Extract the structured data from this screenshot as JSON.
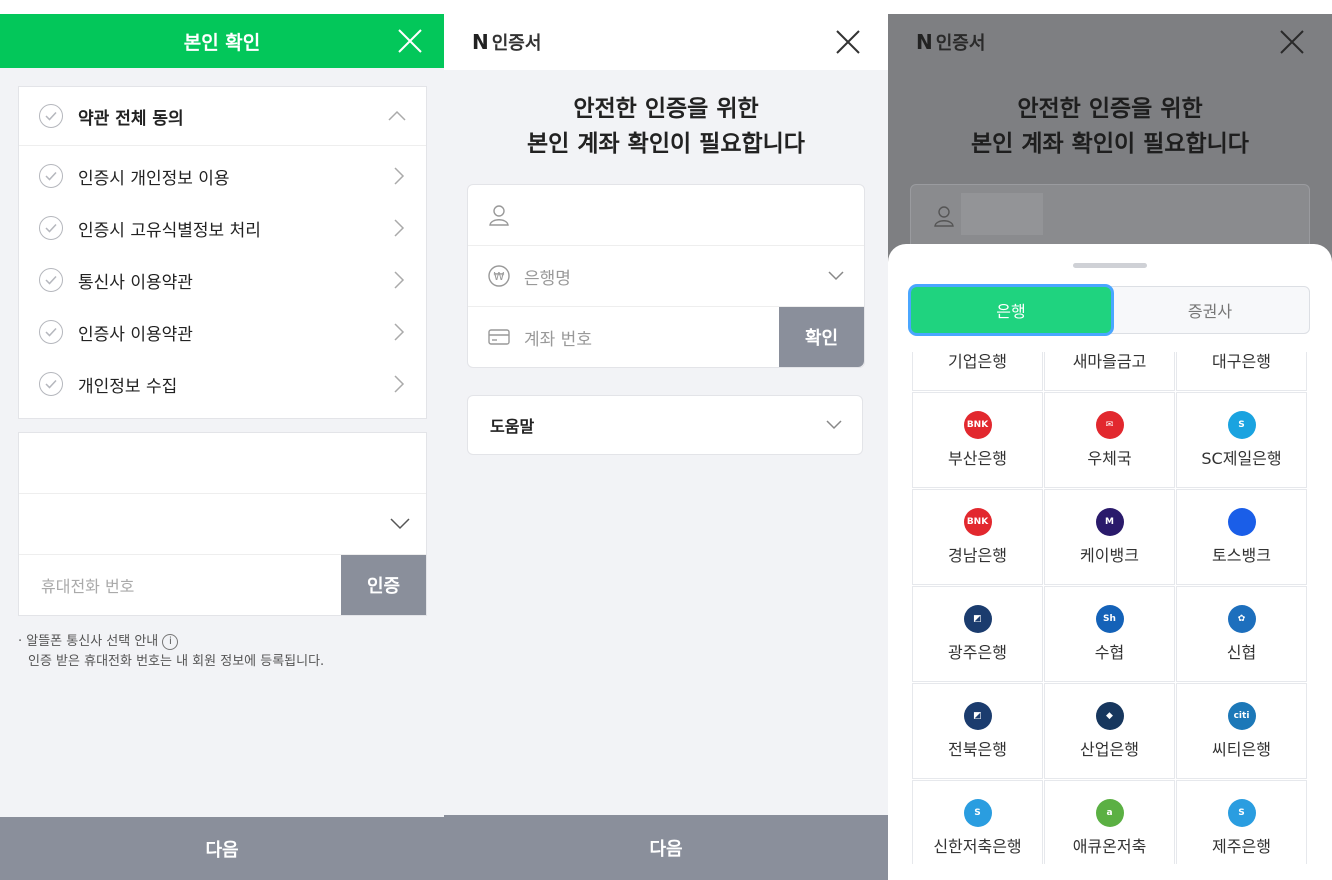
{
  "panel1": {
    "title": "본인 확인",
    "terms": [
      {
        "label": "약관 전체 동의"
      },
      {
        "label": "인증시 개인정보 이용"
      },
      {
        "label": "인증시 고유식별정보 처리"
      },
      {
        "label": "통신사 이용약관"
      },
      {
        "label": "인증사 이용약관"
      },
      {
        "label": "개인정보 수집"
      }
    ],
    "phone_placeholder": "휴대전화 번호",
    "verify_button": "인증",
    "note_line1": "알뜰폰 통신사 선택 안내",
    "note_line2": "인증 받은 휴대전화 번호는 내 회원 정보에 등록됩니다.",
    "next_button": "다음"
  },
  "panel2": {
    "brand_letter": "N",
    "brand_name": "인증서",
    "heading_line1": "안전한 인증을 위한",
    "heading_line2": "본인 계좌 확인이 필요합니다",
    "bank_placeholder": "은행명",
    "account_placeholder": "계좌 번호",
    "confirm_button": "확인",
    "help_label": "도움말",
    "next_button": "다음"
  },
  "panel3": {
    "brand_letter": "N",
    "brand_name": "인증서",
    "heading_line1": "안전한 인증을 위한",
    "heading_line2": "본인 계좌 확인이 필요합니다",
    "tab_bank": "은행",
    "tab_securities": "증권사",
    "banks": [
      {
        "name": "기업은행",
        "color": "#1a5fb4",
        "mark": ""
      },
      {
        "name": "새마을금고",
        "color": "#1f4fa3",
        "mark": ""
      },
      {
        "name": "대구은행",
        "color": "#1d5aa8",
        "mark": ""
      },
      {
        "name": "부산은행",
        "color": "#e2282e",
        "mark": "BNK"
      },
      {
        "name": "우체국",
        "color": "#e2282e",
        "mark": "✉"
      },
      {
        "name": "SC제일은행",
        "color": "#1aa3e0",
        "mark": "S"
      },
      {
        "name": "경남은행",
        "color": "#e2282e",
        "mark": "BNK"
      },
      {
        "name": "케이뱅크",
        "color": "#2a1a6b",
        "mark": "M"
      },
      {
        "name": "토스뱅크",
        "color": "#1a5ee8",
        "mark": ""
      },
      {
        "name": "광주은행",
        "color": "#1b3c6e",
        "mark": "◩"
      },
      {
        "name": "수협",
        "color": "#1462b8",
        "mark": "Sh"
      },
      {
        "name": "신협",
        "color": "#1d6fbd",
        "mark": "✿"
      },
      {
        "name": "전북은행",
        "color": "#1b3c6e",
        "mark": "◩"
      },
      {
        "name": "산업은행",
        "color": "#17375e",
        "mark": "◆"
      },
      {
        "name": "씨티은행",
        "color": "#1c78b8",
        "mark": "citi"
      },
      {
        "name": "신한저축은행",
        "color": "#2a9de0",
        "mark": "S"
      },
      {
        "name": "애큐온저축",
        "color": "#5bb043",
        "mark": "a"
      },
      {
        "name": "제주은행",
        "color": "#2a9de0",
        "mark": "S"
      }
    ]
  }
}
